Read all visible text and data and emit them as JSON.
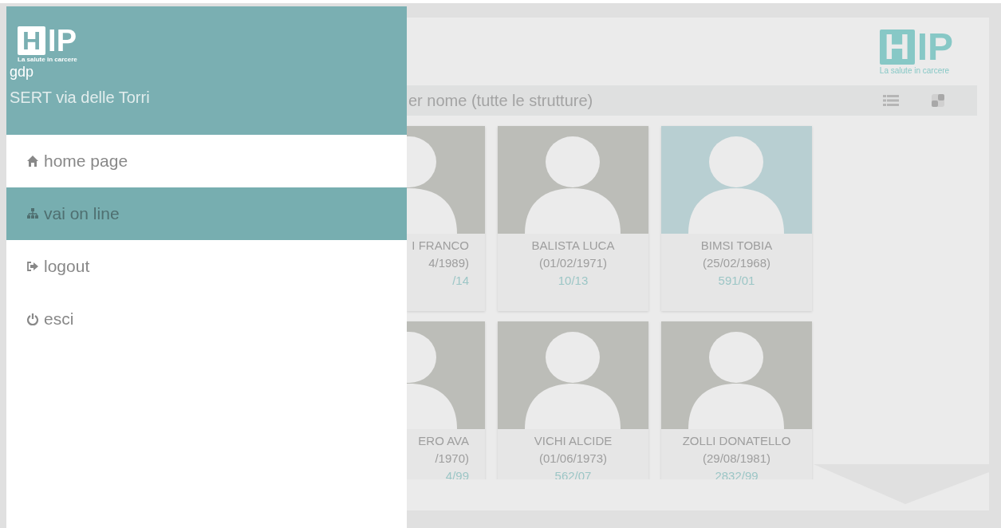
{
  "drawer": {
    "logo": {
      "mark": "H",
      "name": "IP",
      "tagline": "La salute in carcere"
    },
    "user": "gdp",
    "facility": "SERT via delle Torri",
    "items": [
      {
        "kind": "home",
        "label": "home page",
        "selected": false
      },
      {
        "kind": "sitemap",
        "label": "vai on line",
        "selected": true
      },
      {
        "kind": "logout",
        "label": "logout",
        "selected": false
      },
      {
        "kind": "power",
        "label": "esci",
        "selected": false
      }
    ]
  },
  "header": {
    "logo": {
      "mark": "H",
      "name": "IP",
      "tagline": "La salute in carcere"
    }
  },
  "search": {
    "placeholder": "er nome (tutte le strutture)"
  },
  "cards": [
    {
      "name": "I FRANCO",
      "birth": "4/1989)",
      "code": "/14",
      "color": "#bcbdb8",
      "cut": true
    },
    {
      "name": "BALISTA LUCA",
      "birth": "(01/02/1971)",
      "code": "10/13",
      "color": "#bcbdb8",
      "cut": false
    },
    {
      "name": "BIMSI TOBIA",
      "birth": "(25/02/1968)",
      "code": "591/01",
      "color": "#b8cfd2",
      "cut": false
    },
    {
      "name": "ERO AVA",
      "birth": "/1970)",
      "code": "4/99",
      "color": "#bcbdb8",
      "cut": true
    },
    {
      "name": "VICHI ALCIDE",
      "birth": "(01/06/1973)",
      "code": "562/07",
      "color": "#bcbdb8",
      "cut": false
    },
    {
      "name": "ZOLLI DONATELLO",
      "birth": "(29/08/1981)",
      "code": "2832/99",
      "color": "#bcbdb8",
      "cut": false
    }
  ]
}
